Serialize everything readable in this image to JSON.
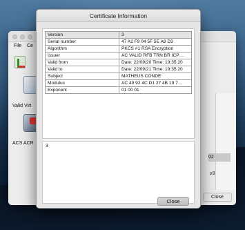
{
  "background_app": {
    "menu": [
      "File",
      "Ce"
    ],
    "items": [
      {
        "label": "Valid Virt"
      },
      {
        "label": "ACS ACR"
      }
    ],
    "selected_item_text": "02",
    "version_text": "v3",
    "close_label": "Close"
  },
  "dialog": {
    "title": "Certificate Information",
    "header": {
      "field": "Version",
      "value": "3"
    },
    "rows": [
      {
        "field": "Serial number",
        "value": "47 A2 F9 04 5F 5E A8 D3"
      },
      {
        "field": "Algorithm",
        "value": "PKCS #1 RSA Encryption"
      },
      {
        "field": "Issuer",
        "value": "AC VALID RFB TRN BR ICP…"
      },
      {
        "field": "Valid from",
        "value": "Date: 22/09/20  Time: 19:35:20"
      },
      {
        "field": "Valid to",
        "value": "Date: 22/09/21  Time: 19:35:20"
      },
      {
        "field": "Subject",
        "value": "MATHEUS CONDE"
      },
      {
        "field": "Modulus",
        "value": "AC 49 92 4C D1 27 4B 19 7…"
      },
      {
        "field": "Exponent",
        "value": "01 00 01"
      }
    ],
    "detail_value": "3",
    "close_label": "Close"
  }
}
